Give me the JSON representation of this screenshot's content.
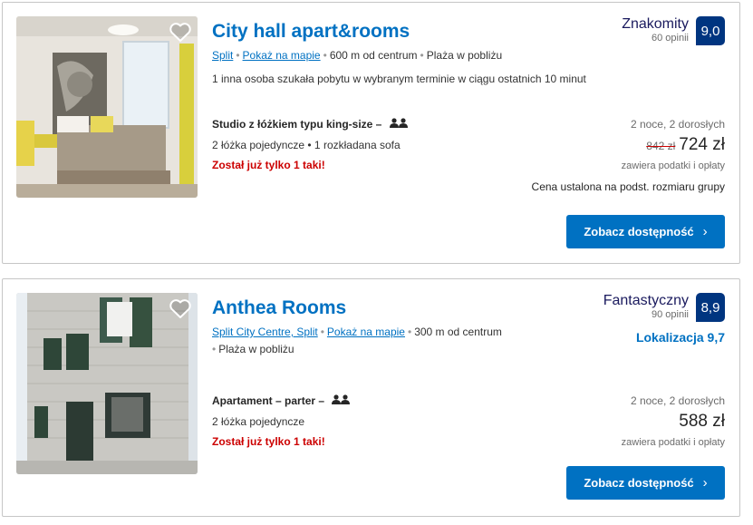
{
  "colors": {
    "brand_blue": "#0071c2",
    "badge_navy": "#003580",
    "warning_red": "#cc0000"
  },
  "listings": [
    {
      "title": "City hall apart&rooms",
      "location": {
        "city": "Split",
        "map_link": "Pokaż na mapie",
        "distance": "600 m od centrum",
        "extra": "Plaża w pobliżu"
      },
      "activity_note": "1 inna osoba szukała pobytu w wybranym terminie w ciągu ostatnich 10 minut",
      "rating": {
        "word": "Znakomity",
        "reviews": "60 opinii",
        "score": "9,0"
      },
      "room_type": "Studio z łóżkiem typu king-size –",
      "beds": "2 łóżka pojedyncze • 1 rozkładana sofa",
      "availability": "Został już tylko 1 taki!",
      "stay_info": "2 noce, 2 dorosłych",
      "old_price": "842 zł",
      "price": "724 zł",
      "tax_note": "zawiera podatki i opłaty",
      "group_note": "Cena ustalona na podst. rozmiaru grupy",
      "cta": "Zobacz dostępność",
      "favorite_icon": "heart-outline-icon",
      "guests_icon": "two-people-icon"
    },
    {
      "title": "Anthea Rooms",
      "location": {
        "city": "Split City Centre, Split",
        "map_link": "Pokaż na mapie",
        "distance": "300 m od centrum",
        "extra": "Plaża w pobliżu"
      },
      "rating": {
        "word": "Fantastyczny",
        "reviews": "90 opinii",
        "score": "8,9"
      },
      "location_score": "Lokalizacja 9,7",
      "room_type": "Apartament – parter –",
      "beds": "2 łóżka pojedyncze",
      "availability": "Został już tylko 1 taki!",
      "stay_info": "2 noce, 2 dorosłych",
      "price": "588 zł",
      "tax_note": "zawiera podatki i opłaty",
      "cta": "Zobacz dostępność",
      "favorite_icon": "heart-outline-icon",
      "guests_icon": "two-people-icon"
    }
  ]
}
